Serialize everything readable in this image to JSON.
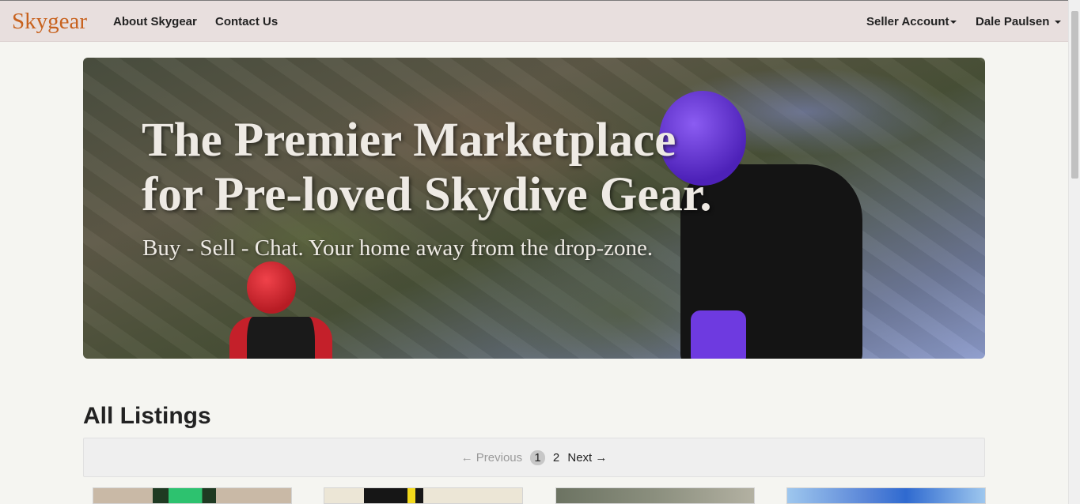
{
  "navbar": {
    "brand": "Skygear",
    "links": [
      {
        "label": "About Skygear"
      },
      {
        "label": "Contact Us"
      }
    ],
    "seller_menu": "Seller Account",
    "user_menu": "Dale Paulsen"
  },
  "hero": {
    "title_line1": "The Premier Marketplace",
    "title_line2": "for Pre-loved Skydive Gear.",
    "subtitle": "Buy - Sell - Chat. Your home away from the drop-zone."
  },
  "listings": {
    "title": "All Listings",
    "pagination": {
      "previous": "← Previous",
      "pages": [
        "1",
        "2"
      ],
      "current": "1",
      "next": "Next →"
    }
  },
  "colors": {
    "brand": "#c8621e",
    "navbar_bg": "#e8dfde",
    "page_bg": "#f5f5f1"
  }
}
